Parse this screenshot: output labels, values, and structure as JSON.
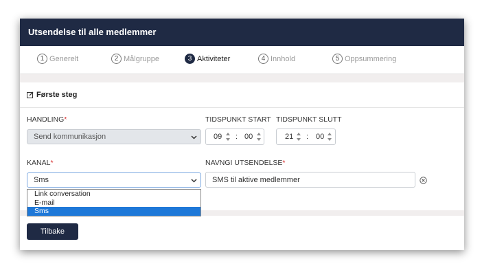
{
  "header": {
    "title": "Utsendelse til alle medlemmer"
  },
  "steps": [
    {
      "num": "1",
      "label": "Generelt"
    },
    {
      "num": "2",
      "label": "Målgruppe"
    },
    {
      "num": "3",
      "label": "Aktiviteter"
    },
    {
      "num": "4",
      "label": "Innhold"
    },
    {
      "num": "5",
      "label": "Oppsummering"
    }
  ],
  "active_step": "3",
  "card": {
    "title": "Første steg"
  },
  "form": {
    "handling_label": "HANDLING",
    "handling_value": "Send kommunikasjon",
    "start_label": "TIDSPUNKT START",
    "start_hour": "09",
    "start_minute": "00",
    "end_label": "TIDSPUNKT SLUTT",
    "end_hour": "21",
    "end_minute": "00",
    "kanal_label": "KANAL",
    "kanal_value": "Sms",
    "navngi_label": "NAVNGI UTSENDELSE",
    "navngi_value": "SMS til aktive medlemmer",
    "required_mark": "*",
    "time_separator": ":"
  },
  "kanal_options": [
    "Link conversation",
    "E-mail",
    "Sms"
  ],
  "kanal_selected_index": 2,
  "footer": {
    "back_label": "Tilbake"
  },
  "icons": {
    "edit": "edit-icon",
    "clear": "clear-circle-x-icon",
    "chevron": "chevron-down-icon"
  },
  "colors": {
    "header_bg": "#1f2a44",
    "selection": "#1e78d8",
    "required": "#d62b2b"
  }
}
